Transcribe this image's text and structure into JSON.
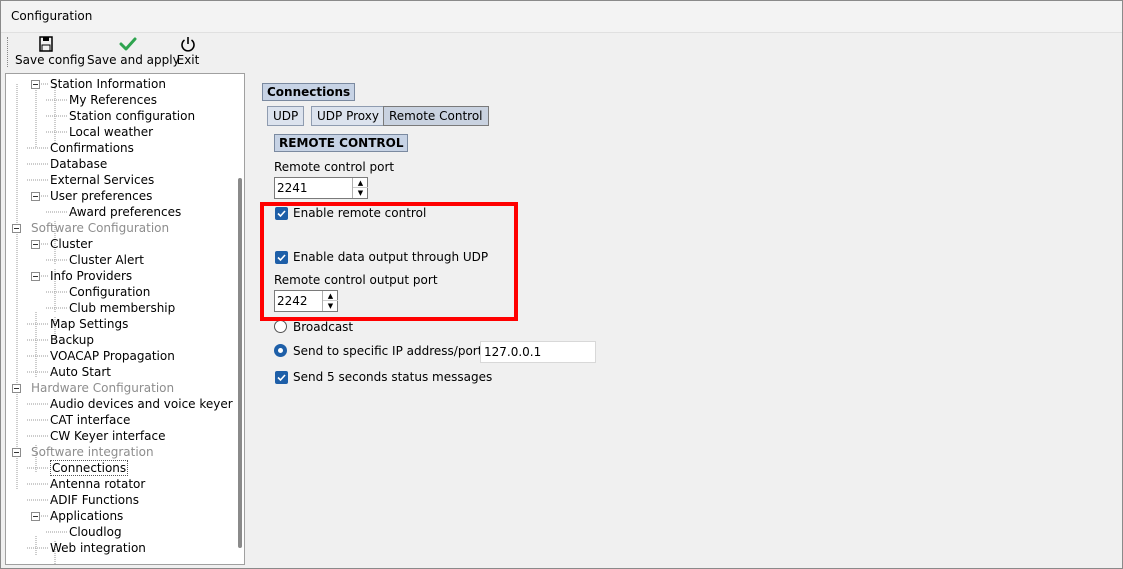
{
  "window": {
    "title": "Configuration"
  },
  "toolbar": {
    "save_config": "Save config",
    "save_and_apply": "Save and apply",
    "exit": "Exit"
  },
  "tree": [
    {
      "label": "Station Information",
      "level": 1,
      "expander": true
    },
    {
      "label": "My References",
      "level": 2
    },
    {
      "label": "Station configuration",
      "level": 2
    },
    {
      "label": "Local weather",
      "level": 2
    },
    {
      "label": "Confirmations",
      "level": 1
    },
    {
      "label": "Database",
      "level": 1
    },
    {
      "label": "External Services",
      "level": 1
    },
    {
      "label": "User preferences",
      "level": 1,
      "expander": true
    },
    {
      "label": "Award preferences",
      "level": 2
    },
    {
      "label": "Software Configuration",
      "level": 0,
      "expander": true,
      "disabled": true
    },
    {
      "label": "Cluster",
      "level": 1,
      "expander": true
    },
    {
      "label": "Cluster Alert",
      "level": 2
    },
    {
      "label": "Info Providers",
      "level": 1,
      "expander": true
    },
    {
      "label": "Configuration",
      "level": 2
    },
    {
      "label": "Club membership",
      "level": 2
    },
    {
      "label": "Map Settings",
      "level": 1
    },
    {
      "label": "Backup",
      "level": 1
    },
    {
      "label": "VOACAP Propagation",
      "level": 1
    },
    {
      "label": "Auto Start",
      "level": 1
    },
    {
      "label": "Hardware Configuration",
      "level": 0,
      "expander": true,
      "disabled": true
    },
    {
      "label": "Audio devices and voice keyer",
      "level": 1
    },
    {
      "label": "CAT interface",
      "level": 1
    },
    {
      "label": "CW Keyer interface",
      "level": 1
    },
    {
      "label": "Software integration",
      "level": 0,
      "expander": true,
      "disabled": true
    },
    {
      "label": "Connections",
      "level": 1,
      "selected": true
    },
    {
      "label": "Antenna rotator",
      "level": 1
    },
    {
      "label": "ADIF Functions",
      "level": 1
    },
    {
      "label": "Applications",
      "level": 1,
      "expander": true
    },
    {
      "label": "Cloudlog",
      "level": 2
    },
    {
      "label": "Web integration",
      "level": 1
    }
  ],
  "panel": {
    "heading": "Connections",
    "tabs": [
      "UDP",
      "UDP Proxy",
      "Remote Control"
    ],
    "active_tab": "Remote Control",
    "subheading": "REMOTE CONTROL",
    "remote_port_label": "Remote control port",
    "remote_port_value": "2241",
    "enable_remote_label": "Enable remote control",
    "enable_remote_checked": true,
    "enable_udp_label": "Enable data output through UDP",
    "enable_udp_checked": true,
    "output_port_label": "Remote control output port",
    "output_port_value": "2242",
    "broadcast_label": "Broadcast",
    "broadcast_selected": false,
    "specific_ip_label": "Send to specific IP address/port",
    "specific_ip_selected": true,
    "ip_value": "127.0.0.1",
    "status_label": "Send 5 seconds status messages",
    "status_checked": true
  },
  "colors": {
    "accent": "#1e5fa8",
    "highlight_border": "#ff0000",
    "section_bg": "#c7d3e5"
  }
}
